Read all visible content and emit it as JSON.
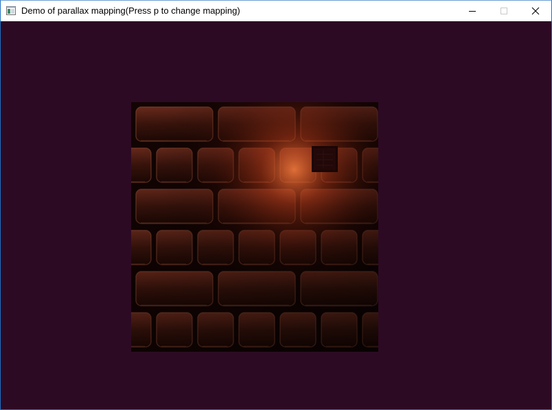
{
  "window": {
    "title": "Demo of parallax mapping(Press p to change mapping)",
    "icon": "application-window-icon",
    "controls": {
      "minimize": "minimize-icon",
      "maximize": "maximize-icon",
      "close": "close-icon"
    }
  },
  "viewport": {
    "clear_color": "#2d0a24",
    "scene": "brick-wall-quad",
    "light_color": "#ff7a3a"
  }
}
